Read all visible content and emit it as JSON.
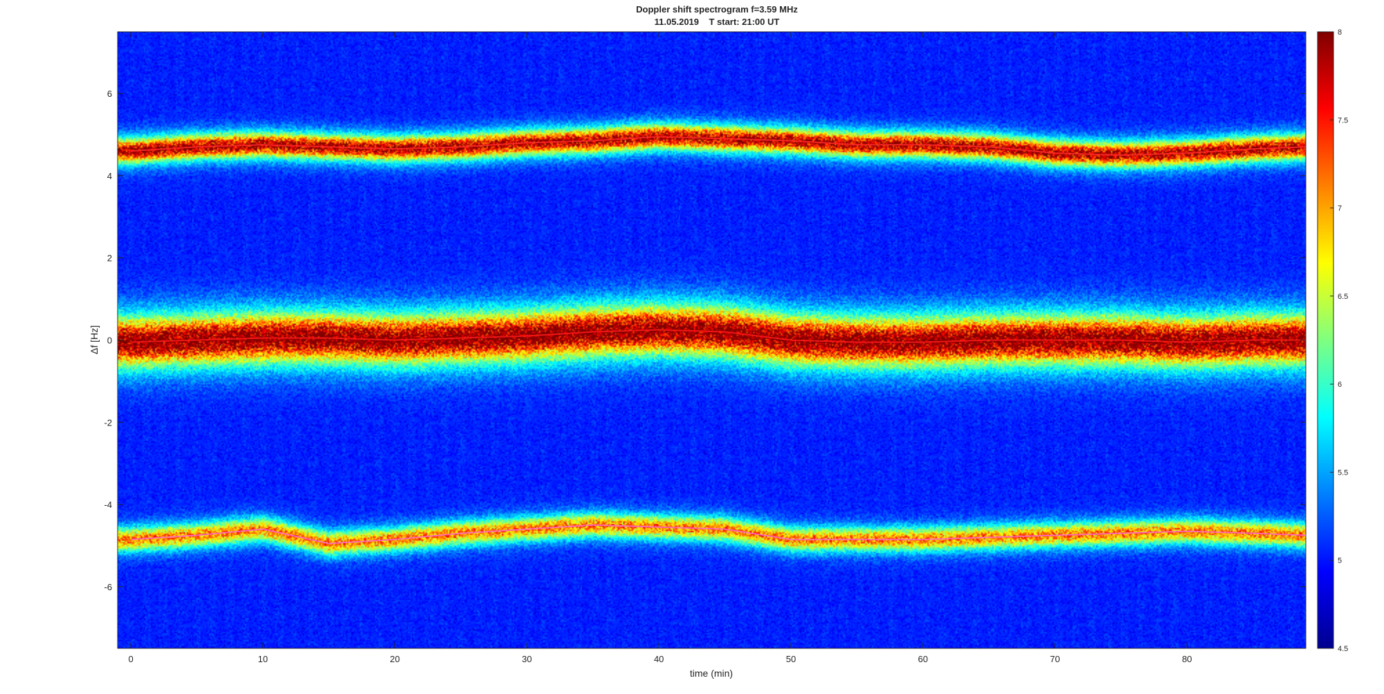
{
  "chart_data": {
    "type": "heatmap",
    "title_line1": "Doppler shift spectrogram f=3.59 MHz",
    "title_line2": "11.05.2019    T start: 21:00 UT",
    "xlabel": "time (min)",
    "ylabel": "Δf [Hz]",
    "xlim": [
      -1,
      89
    ],
    "ylim": [
      -7.5,
      7.5
    ],
    "x_ticks": [
      0,
      10,
      20,
      30,
      40,
      50,
      60,
      70,
      80
    ],
    "y_ticks": [
      6,
      4,
      2,
      0,
      -2,
      -4,
      -6
    ],
    "colorbar": {
      "colormap": "jet",
      "limits": [
        4.5,
        8
      ],
      "ticks": [
        8,
        7.5,
        7,
        6.5,
        6,
        5.5,
        5,
        4.5
      ]
    },
    "background_level": 4.9,
    "series": [
      {
        "ridge": "upper",
        "x": [
          0,
          5,
          10,
          15,
          20,
          25,
          30,
          35,
          40,
          45,
          50,
          55,
          60,
          65,
          70,
          75,
          80,
          85,
          89
        ],
        "y": [
          4.6,
          4.7,
          4.75,
          4.7,
          4.65,
          4.7,
          4.8,
          4.85,
          4.95,
          4.9,
          4.85,
          4.75,
          4.75,
          4.7,
          4.55,
          4.5,
          4.55,
          4.65,
          4.7
        ],
        "peak_level": 7.7,
        "width_hz": 0.45
      },
      {
        "ridge": "center",
        "x": [
          0,
          5,
          10,
          15,
          20,
          25,
          30,
          35,
          40,
          45,
          50,
          55,
          60,
          65,
          70,
          75,
          80,
          85,
          89
        ],
        "y": [
          -0.05,
          0.0,
          0.05,
          0.05,
          0.0,
          0.05,
          0.1,
          0.2,
          0.25,
          0.2,
          0.0,
          -0.05,
          -0.05,
          0.0,
          0.0,
          0.0,
          -0.05,
          0.0,
          0.0
        ],
        "peak_level": 7.9,
        "width_hz": 0.9
      },
      {
        "ridge": "lower",
        "x": [
          0,
          5,
          10,
          15,
          20,
          25,
          30,
          35,
          40,
          45,
          50,
          55,
          60,
          65,
          70,
          75,
          80,
          85,
          89
        ],
        "y": [
          -4.85,
          -4.75,
          -4.6,
          -4.95,
          -4.85,
          -4.7,
          -4.6,
          -4.5,
          -4.55,
          -4.6,
          -4.85,
          -4.85,
          -4.85,
          -4.8,
          -4.75,
          -4.7,
          -4.65,
          -4.7,
          -4.75
        ],
        "peak_level": 7.0,
        "width_hz": 0.45
      }
    ]
  }
}
